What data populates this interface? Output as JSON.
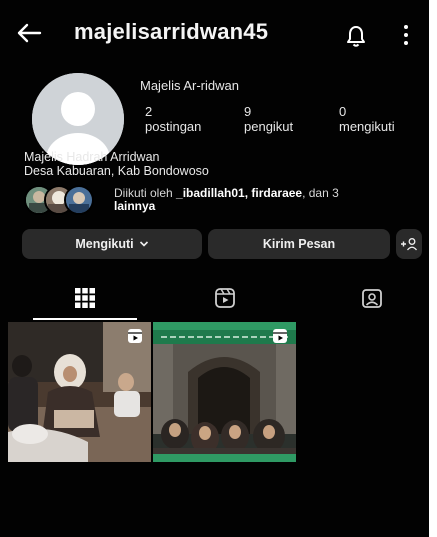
{
  "header": {
    "username": "majelisarridwan45",
    "icons": [
      "back-arrow-icon",
      "bell-icon",
      "more-vertical-icon"
    ]
  },
  "profile": {
    "display_name": "Majelis Ar-ridwan",
    "stats": [
      {
        "value": "2",
        "label": "postingan"
      },
      {
        "value": "9",
        "label": "pengikut"
      },
      {
        "value": "0",
        "label": "mengikuti"
      }
    ],
    "bio": {
      "line1": "Majelis Hadrah Arridwan",
      "line2": "Desa Kabuaran, Kab Bondowoso"
    },
    "followed_by": {
      "prefix": "Diikuti oleh ",
      "names": "_ibadillah01, firdaraee",
      "suffix_1": ", dan 3",
      "suffix_2": "lainnya"
    }
  },
  "actions": {
    "follow_label": "Mengikuti",
    "message_label": "Kirim Pesan"
  },
  "tabs": [
    "grid-icon",
    "reels-icon",
    "tagged-icon"
  ],
  "posts": [
    {
      "type": "reel",
      "badge": "reel-icon"
    },
    {
      "type": "reel",
      "badge": "reel-icon"
    }
  ],
  "colors": {
    "background": "#000000",
    "button": "#2a2a2a",
    "text": "#f5f5f5",
    "accent_green": "#2f9a64"
  }
}
